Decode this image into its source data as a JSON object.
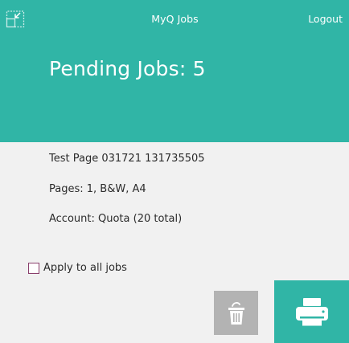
{
  "header": {
    "app_title": "MyQ Jobs",
    "logout_label": "Logout",
    "pending_jobs_label": "Pending Jobs: 5",
    "minimize_icon": "minimize-icon"
  },
  "job": {
    "name": "Test Page 031721 131735505",
    "pages": "Pages: 1, B&W, A4",
    "account": "Account: Quota (20 total)"
  },
  "options": {
    "apply_all_label": "Apply to all jobs",
    "apply_all_checked": false
  },
  "actions": {
    "delete_icon": "trash-icon",
    "print_icon": "printer-icon"
  },
  "colors": {
    "accent": "#30b5a6",
    "background": "#f1f1f1",
    "delete_button": "#b3b3b3",
    "checkbox_border": "#8a3f6c"
  }
}
